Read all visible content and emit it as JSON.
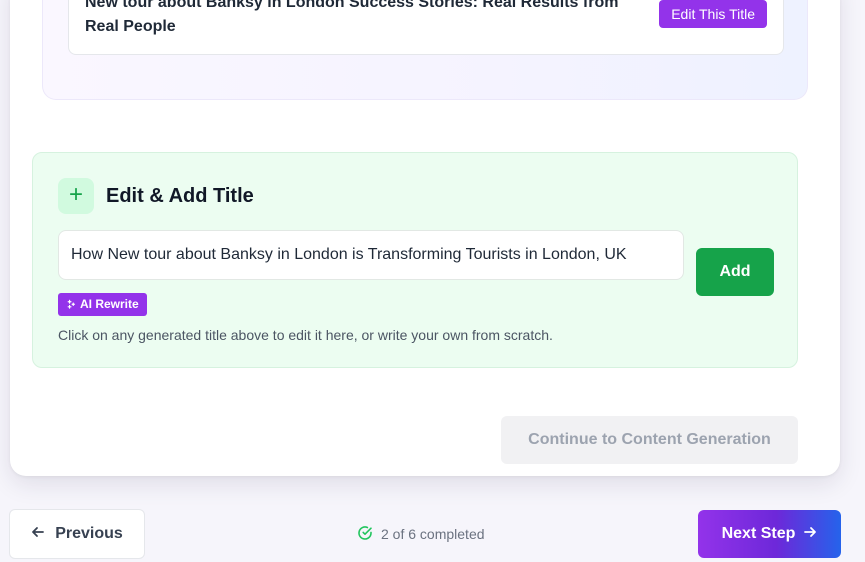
{
  "generated_titles": {
    "item": {
      "text": "New tour about Banksy in London Success Stories: Real Results from Real People",
      "edit_label": "Edit This Title"
    }
  },
  "add_section": {
    "icon": "plus-icon",
    "heading": "Edit & Add Title",
    "input_value": "How New tour about Banksy in London is Transforming Tourists in London, UK",
    "ai_rewrite_label": "AI Rewrite",
    "ai_rewrite_icon": "sparkles-icon",
    "helper": "Click on any generated title above to edit it here, or write your own from scratch.",
    "add_label": "Add"
  },
  "continue_label": "Continue to Content Generation",
  "footer": {
    "previous_label": "Previous",
    "previous_icon": "arrow-left-icon",
    "progress_text": "2 of 6 completed",
    "progress_icon": "check-circle-icon",
    "next_label": "Next Step",
    "next_icon": "arrow-right-icon"
  },
  "colors": {
    "accent_purple": "#9333ea",
    "success_green": "#16a34a",
    "add_section_bg": "#ecfdf1",
    "disabled_bg": "#f1f1f3"
  }
}
